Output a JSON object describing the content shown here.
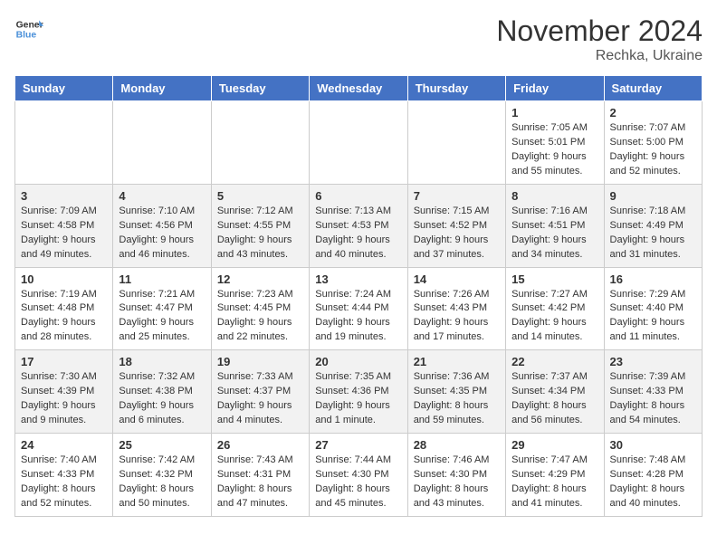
{
  "logo": {
    "line1": "General",
    "line2": "Blue"
  },
  "title": "November 2024",
  "subtitle": "Rechka, Ukraine",
  "days_header": [
    "Sunday",
    "Monday",
    "Tuesday",
    "Wednesday",
    "Thursday",
    "Friday",
    "Saturday"
  ],
  "weeks": [
    [
      {
        "num": "",
        "info": ""
      },
      {
        "num": "",
        "info": ""
      },
      {
        "num": "",
        "info": ""
      },
      {
        "num": "",
        "info": ""
      },
      {
        "num": "",
        "info": ""
      },
      {
        "num": "1",
        "info": "Sunrise: 7:05 AM\nSunset: 5:01 PM\nDaylight: 9 hours and 55 minutes."
      },
      {
        "num": "2",
        "info": "Sunrise: 7:07 AM\nSunset: 5:00 PM\nDaylight: 9 hours and 52 minutes."
      }
    ],
    [
      {
        "num": "3",
        "info": "Sunrise: 7:09 AM\nSunset: 4:58 PM\nDaylight: 9 hours and 49 minutes."
      },
      {
        "num": "4",
        "info": "Sunrise: 7:10 AM\nSunset: 4:56 PM\nDaylight: 9 hours and 46 minutes."
      },
      {
        "num": "5",
        "info": "Sunrise: 7:12 AM\nSunset: 4:55 PM\nDaylight: 9 hours and 43 minutes."
      },
      {
        "num": "6",
        "info": "Sunrise: 7:13 AM\nSunset: 4:53 PM\nDaylight: 9 hours and 40 minutes."
      },
      {
        "num": "7",
        "info": "Sunrise: 7:15 AM\nSunset: 4:52 PM\nDaylight: 9 hours and 37 minutes."
      },
      {
        "num": "8",
        "info": "Sunrise: 7:16 AM\nSunset: 4:51 PM\nDaylight: 9 hours and 34 minutes."
      },
      {
        "num": "9",
        "info": "Sunrise: 7:18 AM\nSunset: 4:49 PM\nDaylight: 9 hours and 31 minutes."
      }
    ],
    [
      {
        "num": "10",
        "info": "Sunrise: 7:19 AM\nSunset: 4:48 PM\nDaylight: 9 hours and 28 minutes."
      },
      {
        "num": "11",
        "info": "Sunrise: 7:21 AM\nSunset: 4:47 PM\nDaylight: 9 hours and 25 minutes."
      },
      {
        "num": "12",
        "info": "Sunrise: 7:23 AM\nSunset: 4:45 PM\nDaylight: 9 hours and 22 minutes."
      },
      {
        "num": "13",
        "info": "Sunrise: 7:24 AM\nSunset: 4:44 PM\nDaylight: 9 hours and 19 minutes."
      },
      {
        "num": "14",
        "info": "Sunrise: 7:26 AM\nSunset: 4:43 PM\nDaylight: 9 hours and 17 minutes."
      },
      {
        "num": "15",
        "info": "Sunrise: 7:27 AM\nSunset: 4:42 PM\nDaylight: 9 hours and 14 minutes."
      },
      {
        "num": "16",
        "info": "Sunrise: 7:29 AM\nSunset: 4:40 PM\nDaylight: 9 hours and 11 minutes."
      }
    ],
    [
      {
        "num": "17",
        "info": "Sunrise: 7:30 AM\nSunset: 4:39 PM\nDaylight: 9 hours and 9 minutes."
      },
      {
        "num": "18",
        "info": "Sunrise: 7:32 AM\nSunset: 4:38 PM\nDaylight: 9 hours and 6 minutes."
      },
      {
        "num": "19",
        "info": "Sunrise: 7:33 AM\nSunset: 4:37 PM\nDaylight: 9 hours and 4 minutes."
      },
      {
        "num": "20",
        "info": "Sunrise: 7:35 AM\nSunset: 4:36 PM\nDaylight: 9 hours and 1 minute."
      },
      {
        "num": "21",
        "info": "Sunrise: 7:36 AM\nSunset: 4:35 PM\nDaylight: 8 hours and 59 minutes."
      },
      {
        "num": "22",
        "info": "Sunrise: 7:37 AM\nSunset: 4:34 PM\nDaylight: 8 hours and 56 minutes."
      },
      {
        "num": "23",
        "info": "Sunrise: 7:39 AM\nSunset: 4:33 PM\nDaylight: 8 hours and 54 minutes."
      }
    ],
    [
      {
        "num": "24",
        "info": "Sunrise: 7:40 AM\nSunset: 4:33 PM\nDaylight: 8 hours and 52 minutes."
      },
      {
        "num": "25",
        "info": "Sunrise: 7:42 AM\nSunset: 4:32 PM\nDaylight: 8 hours and 50 minutes."
      },
      {
        "num": "26",
        "info": "Sunrise: 7:43 AM\nSunset: 4:31 PM\nDaylight: 8 hours and 47 minutes."
      },
      {
        "num": "27",
        "info": "Sunrise: 7:44 AM\nSunset: 4:30 PM\nDaylight: 8 hours and 45 minutes."
      },
      {
        "num": "28",
        "info": "Sunrise: 7:46 AM\nSunset: 4:30 PM\nDaylight: 8 hours and 43 minutes."
      },
      {
        "num": "29",
        "info": "Sunrise: 7:47 AM\nSunset: 4:29 PM\nDaylight: 8 hours and 41 minutes."
      },
      {
        "num": "30",
        "info": "Sunrise: 7:48 AM\nSunset: 4:28 PM\nDaylight: 8 hours and 40 minutes."
      }
    ]
  ]
}
